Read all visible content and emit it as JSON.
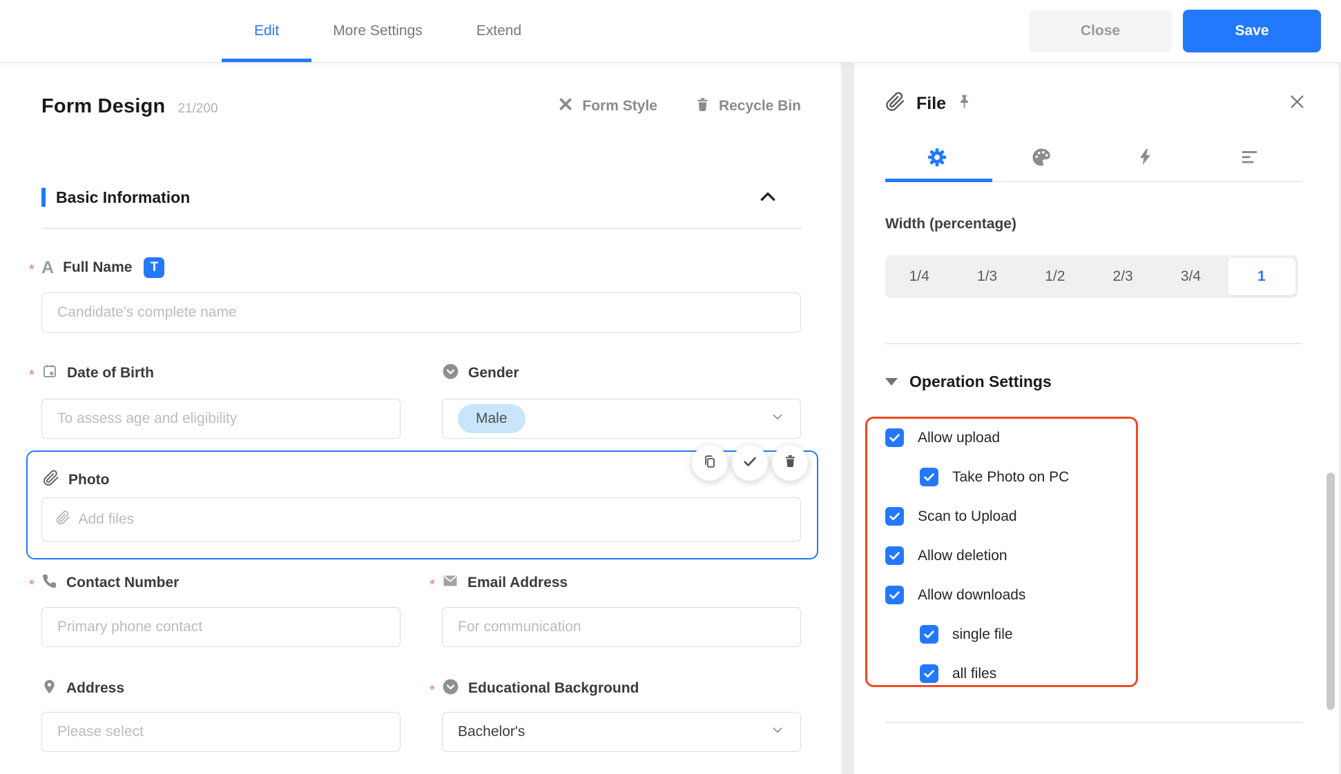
{
  "colors": {
    "accent": "#2379fc",
    "highlight": "#f24822",
    "male_pill_bg": "#c9e5f9"
  },
  "required_marker": "*",
  "topbar": {
    "tabs": [
      {
        "label": "Edit",
        "active": true
      },
      {
        "label": "More Settings",
        "active": false
      },
      {
        "label": "Extend",
        "active": false
      }
    ],
    "close_label": "Close",
    "save_label": "Save"
  },
  "canvas": {
    "title": "Form Design",
    "counter": "21/200",
    "form_style_label": "Form Style",
    "recycle_bin_label": "Recycle Bin",
    "section_title": "Basic Information",
    "fields": {
      "full_name": {
        "label": "Full Name",
        "required": true,
        "badge": "T",
        "placeholder": "Candidate's complete name"
      },
      "date_of_birth": {
        "label": "Date of Birth",
        "required": true,
        "placeholder": "To assess age and eligibility"
      },
      "gender": {
        "label": "Gender",
        "required": false,
        "value": "Male"
      },
      "photo": {
        "label": "Photo",
        "required": false,
        "placeholder": "Add files",
        "selected": true
      },
      "contact_number": {
        "label": "Contact Number",
        "required": true,
        "placeholder": "Primary phone contact"
      },
      "email_address": {
        "label": "Email Address",
        "required": true,
        "placeholder": "For communication"
      },
      "address": {
        "label": "Address",
        "required": false,
        "placeholder": "Please select"
      },
      "educational_background": {
        "label": "Educational Background",
        "required": true,
        "value": "Bachelor's"
      }
    }
  },
  "panel": {
    "title": "File",
    "width": {
      "label": "Width (percentage)",
      "options": [
        {
          "label": "1/4",
          "selected": false
        },
        {
          "label": "1/3",
          "selected": false
        },
        {
          "label": "1/2",
          "selected": false
        },
        {
          "label": "2/3",
          "selected": false
        },
        {
          "label": "3/4",
          "selected": false
        },
        {
          "label": "1",
          "selected": true
        }
      ]
    },
    "operation": {
      "title": "Operation Settings",
      "items": [
        {
          "label": "Allow upload",
          "checked": true,
          "indent": false
        },
        {
          "label": "Take Photo on PC",
          "checked": true,
          "indent": true
        },
        {
          "label": "Scan to Upload",
          "checked": true,
          "indent": false
        },
        {
          "label": "Allow deletion",
          "checked": true,
          "indent": false
        },
        {
          "label": "Allow downloads",
          "checked": true,
          "indent": false
        },
        {
          "label": "single file",
          "checked": true,
          "indent": true
        },
        {
          "label": "all files",
          "checked": true,
          "indent": true
        }
      ]
    }
  },
  "icons": [
    "paperclip-icon",
    "pin-icon",
    "close-icon",
    "gear-icon",
    "palette-icon",
    "lightning-icon",
    "sort-lines-icon",
    "form-style-icon",
    "trash-icon",
    "calendar-icon",
    "circle-dropdown-icon",
    "phone-icon",
    "envelope-icon",
    "location-pin-icon",
    "copy-icon",
    "check-icon",
    "chevron-down-icon",
    "chevron-up-icon",
    "collapse-triangle-icon",
    "text-a-icon",
    "checkbox-check-icon"
  ]
}
